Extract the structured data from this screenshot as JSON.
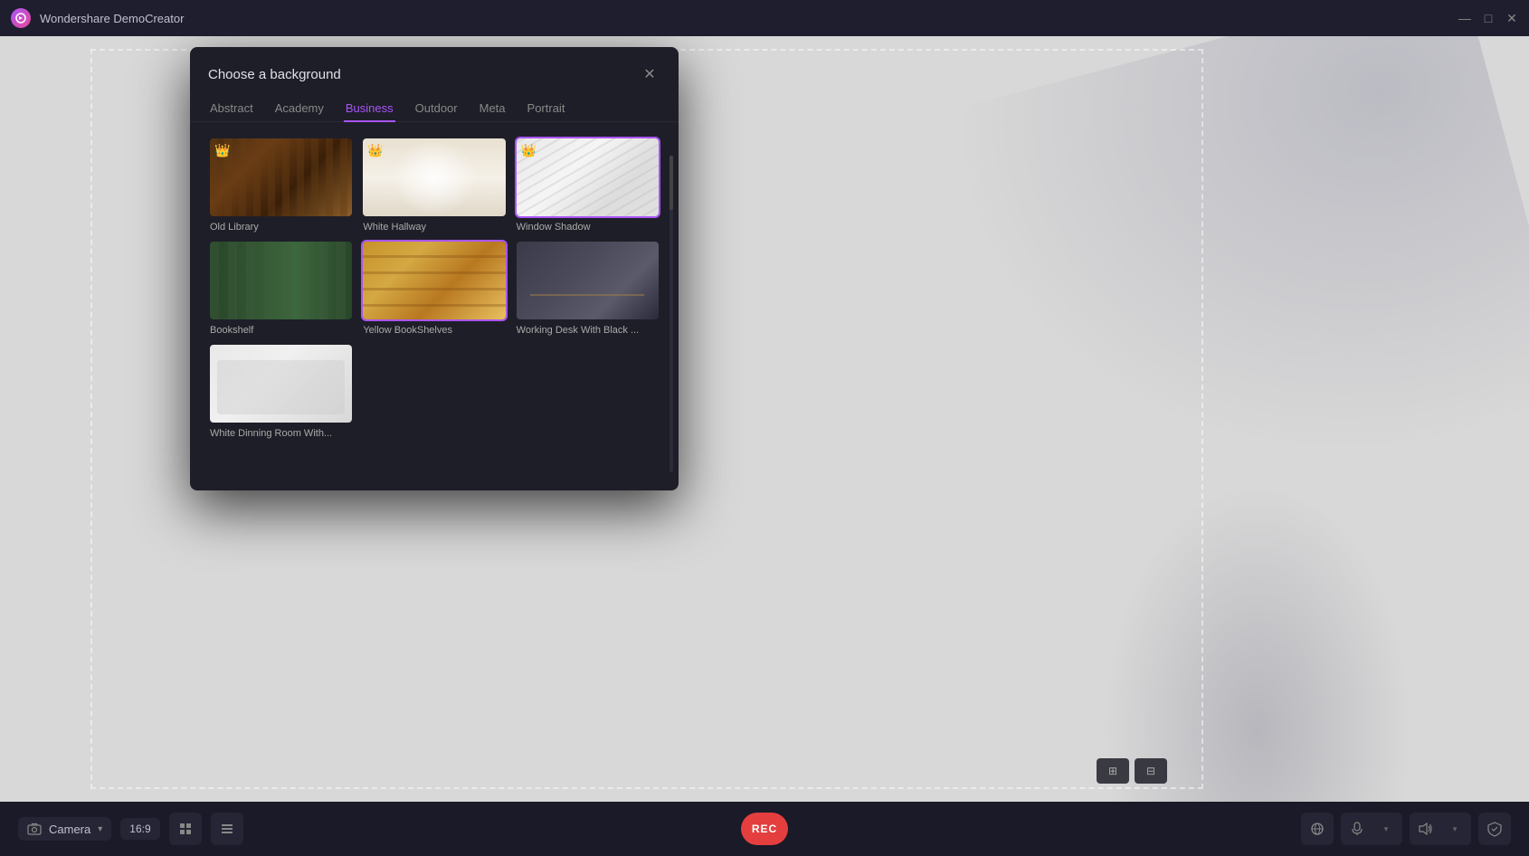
{
  "app": {
    "title": "Wondershare DemoCreator"
  },
  "titlebar": {
    "minimize_label": "—",
    "maximize_label": "□",
    "close_label": "✕"
  },
  "modal": {
    "title": "Choose a background",
    "close_icon": "✕",
    "tabs": [
      {
        "id": "abstract",
        "label": "Abstract",
        "active": false
      },
      {
        "id": "academy",
        "label": "Academy",
        "active": false
      },
      {
        "id": "business",
        "label": "Business",
        "active": true
      },
      {
        "id": "outdoor",
        "label": "Outdoor",
        "active": false
      },
      {
        "id": "meta",
        "label": "Meta",
        "active": false
      },
      {
        "id": "portrait",
        "label": "Portrait",
        "active": false
      }
    ],
    "backgrounds": [
      {
        "id": "old-library",
        "label": "Old Library",
        "selected": false,
        "premium": true,
        "thumb": "library"
      },
      {
        "id": "white-hallway",
        "label": "White Hallway",
        "selected": false,
        "premium": true,
        "thumb": "hallway"
      },
      {
        "id": "window-shadow",
        "label": "Window Shadow",
        "selected": true,
        "premium": true,
        "thumb": "shadow"
      },
      {
        "id": "bookshelf",
        "label": "Bookshelf",
        "selected": false,
        "premium": false,
        "thumb": "bookshelf"
      },
      {
        "id": "yellow-bookshelves",
        "label": "Yellow BookShelves",
        "selected": false,
        "premium": false,
        "thumb": "yellow-shelves"
      },
      {
        "id": "working-desk",
        "label": "Working Desk With Black ...",
        "selected": false,
        "premium": false,
        "thumb": "working-desk"
      },
      {
        "id": "white-dining",
        "label": "White Dinning Room With...",
        "selected": false,
        "premium": false,
        "thumb": "dining"
      }
    ],
    "crown_icon": "👑"
  },
  "bottom_bar": {
    "camera_label": "Camera",
    "camera_arrow": "▾",
    "ratio_label": "16:9",
    "rec_label": "REC",
    "grid_icon": "⊞",
    "list_icon": "≡",
    "mic_icon": "🎤",
    "speaker_icon": "🔊",
    "shield_icon": "⊕",
    "chevron_down": "▾"
  }
}
